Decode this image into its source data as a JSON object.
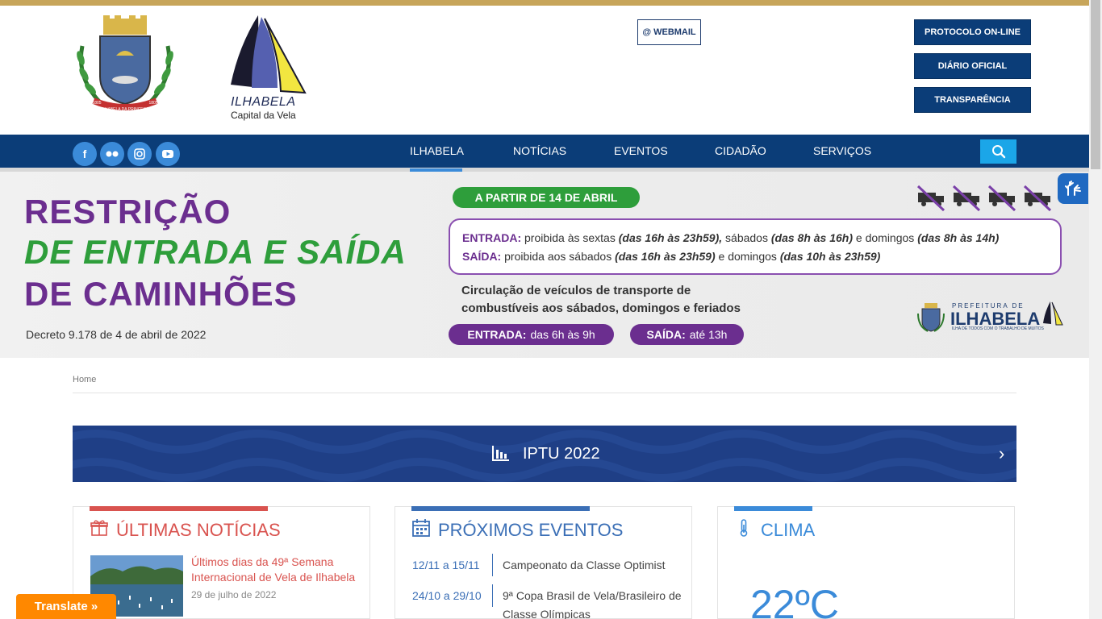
{
  "header": {
    "brand_name": "ILHABELA",
    "brand_subtitle": "Capital da Vela",
    "crest_text": "ILHABELA DA PRINCESA",
    "crest_year_left": "1805",
    "crest_year_right": "1805",
    "webmail_label": "@ WEBMAIL",
    "buttons": [
      "PROTOCOLO ON-LINE",
      "DIÁRIO OFICIAL",
      "TRANSPARÊNCIA"
    ]
  },
  "social": [
    "facebook-icon",
    "flickr-icon",
    "instagram-icon",
    "youtube-icon"
  ],
  "nav": {
    "items": [
      "ILHABELA",
      "NOTÍCIAS",
      "EVENTOS",
      "CIDADÃO",
      "SERVIÇOS"
    ],
    "active": "ILHABELA"
  },
  "banner": {
    "line1": "RESTRIÇÃO",
    "line2": "DE ENTRADA E SAÍDA",
    "line3": "DE CAMINHÕES",
    "decreto": "Decreto 9.178 de 4 de abril de 2022",
    "date_pill": "A PARTIR DE 14 DE ABRIL",
    "entrada_label": "ENTRADA:",
    "entrada_p1": "proibida às sextas",
    "entrada_b1": "(das 16h às 23h59),",
    "entrada_p2": "sábados",
    "entrada_b2": "(das 8h às 16h)",
    "entrada_p3": "e domingos",
    "entrada_b3": "(das 8h às 14h)",
    "saida_label": "SAÍDA:",
    "saida_p1": "proibida aos sábados",
    "saida_b1": "(das 16h às 23h59)",
    "saida_p2": "e domingos",
    "saida_b2": "(das 10h às 23h59)",
    "circ_line1": "Circulação de veículos de transporte de",
    "circ_line2": "combustíveis aos sábados, domingos e feriados",
    "pill_entrada_label": "ENTRADA:",
    "pill_entrada_value": "das 6h às 9h",
    "pill_saida_label": "SAÍDA:",
    "pill_saida_value": "até 13h",
    "prefeitura_small": "PREFEITURA DE",
    "prefeitura_big": "ILHABELA",
    "prefeitura_tag": "ILHA DE TODOS COM O TRABALHO DE MUITOS"
  },
  "breadcrumb": "Home",
  "slider": {
    "label": "IPTU 2022",
    "next": "›"
  },
  "cards": {
    "news": {
      "title": "ÚLTIMAS NOTÍCIAS",
      "color": "#d9534f",
      "item_title": "Últimos dias da 49ª Semana Internacional de Vela de Ilhabela",
      "item_date": "29 de julho de 2022"
    },
    "events": {
      "title": "PRÓXIMOS EVENTOS",
      "color": "#3b6fb6",
      "items": [
        {
          "date": "12/11 a 15/11",
          "name": "Campeonato da Classe Optimist"
        },
        {
          "date": "24/10 a 29/10",
          "name": "9ª Copa Brasil de Vela/Brasileiro de Classe Olímpicas"
        }
      ]
    },
    "clima": {
      "title": "CLIMA",
      "color": "#3b8bd9",
      "temperature": "22ºC"
    }
  },
  "translate": "Translate »"
}
